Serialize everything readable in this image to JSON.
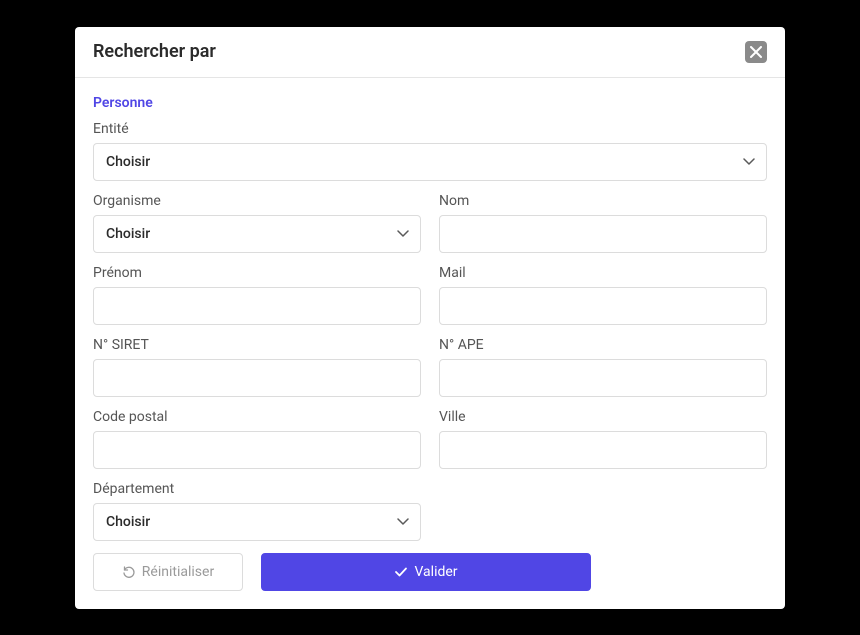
{
  "modal": {
    "title": "Rechercher par",
    "tab": "Personne"
  },
  "fields": {
    "entite": {
      "label": "Entité",
      "value": "Choisir"
    },
    "organisme": {
      "label": "Organisme",
      "value": "Choisir"
    },
    "nom": {
      "label": "Nom",
      "value": ""
    },
    "prenom": {
      "label": "Prénom",
      "value": ""
    },
    "mail": {
      "label": "Mail",
      "value": ""
    },
    "siret": {
      "label": "N° SIRET",
      "value": ""
    },
    "ape": {
      "label": "N° APE",
      "value": ""
    },
    "codepostal": {
      "label": "Code postal",
      "value": ""
    },
    "ville": {
      "label": "Ville",
      "value": ""
    },
    "departement": {
      "label": "Département",
      "value": "Choisir"
    }
  },
  "buttons": {
    "reset": "Réinitialiser",
    "validate": "Valider"
  }
}
